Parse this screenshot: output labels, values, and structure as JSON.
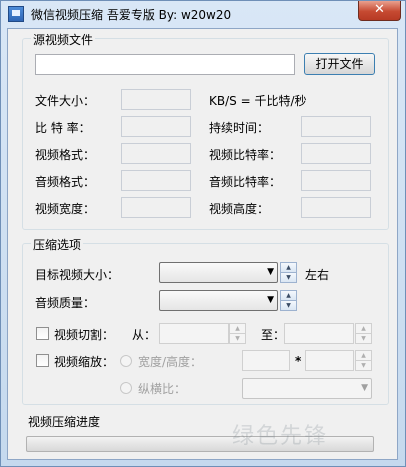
{
  "window": {
    "title": "微信视频压缩  吾爱专版 By: w20w20",
    "close_glyph": "✕",
    "watermark": "绿色先锋"
  },
  "source": {
    "group_label": "源视频文件",
    "file_path": "",
    "open_button": "打开文件",
    "labels": {
      "file_size": "文件大小：",
      "kbs_note": "KB/S = 千比特/秒",
      "bitrate": "比 特 率：",
      "duration": "持续时间：",
      "video_format": "视频格式：",
      "video_bitrate": "视频比特率：",
      "audio_format": "音频格式：",
      "audio_bitrate": "音频比特率：",
      "video_width": "视频宽度：",
      "video_height": "视频高度："
    },
    "values": {
      "file_size": "",
      "bitrate": "",
      "duration": "",
      "video_format": "",
      "video_bitrate": "",
      "audio_format": "",
      "audio_bitrate": "",
      "video_width": "",
      "video_height": ""
    }
  },
  "compress": {
    "group_label": "压缩选项",
    "target_size_label": "目标视频大小：",
    "target_size_value": "",
    "target_size_suffix": "左右",
    "audio_quality_label": "音频质量：",
    "audio_quality_value": "",
    "cut_label": "视频切割：",
    "cut_checked": false,
    "from_label": "从：",
    "to_label": "至：",
    "from_value": "",
    "to_value": "",
    "scale_label": "视频缩放：",
    "scale_checked": false,
    "wh_label": "宽度/高度：",
    "times_sign": "*",
    "width_value": "",
    "height_value": "",
    "ratio_label": "纵横比：",
    "ratio_value": ""
  },
  "progress": {
    "label": "视频压缩进度",
    "value": 0
  },
  "icons": {
    "app": "app-icon",
    "close": "close-icon",
    "dropdown": "chevron-down-icon",
    "spin_up": "spin-up-icon",
    "spin_down": "spin-down-icon"
  }
}
